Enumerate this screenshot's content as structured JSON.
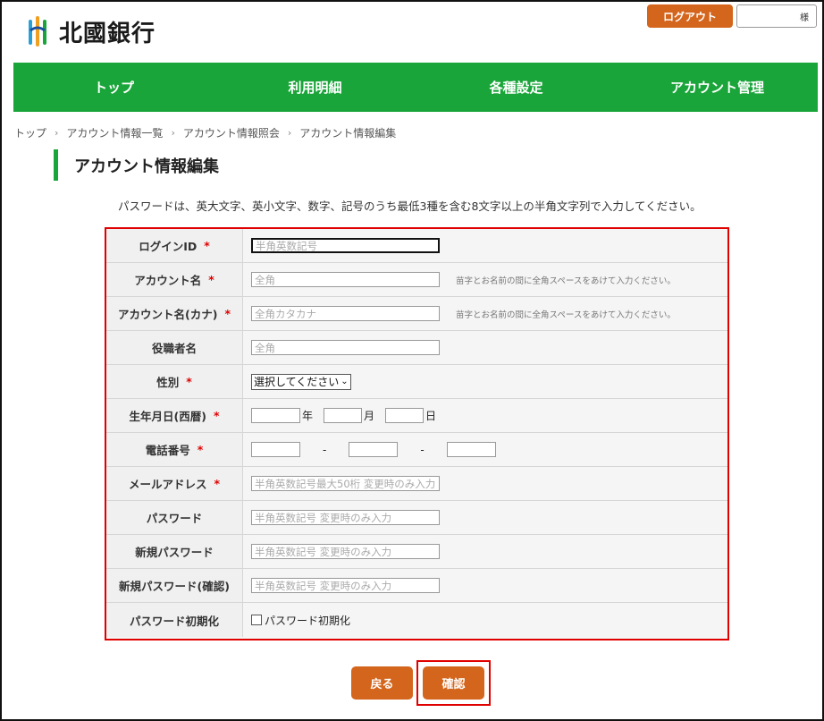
{
  "header": {
    "bank_name": "北國銀行",
    "logout_label": "ログアウト",
    "user_suffix": "様"
  },
  "nav": [
    {
      "label": "トップ"
    },
    {
      "label": "利用明細"
    },
    {
      "label": "各種設定"
    },
    {
      "label": "アカウント管理"
    }
  ],
  "breadcrumb": [
    {
      "label": "トップ"
    },
    {
      "label": "アカウント情報一覧"
    },
    {
      "label": "アカウント情報照会"
    },
    {
      "label": "アカウント情報編集"
    }
  ],
  "page_title": "アカウント情報編集",
  "notice": "パスワードは、英大文字、英小文字、数字、記号のうち最低3種を含む8文字以上の半角文字列で入力してください。",
  "form": {
    "login_id": {
      "label": "ログインID",
      "placeholder": "半角英数記号"
    },
    "account_name": {
      "label": "アカウント名",
      "placeholder": "全角",
      "hint": "苗字とお名前の間に全角スペースをあけて入力ください。"
    },
    "account_kana": {
      "label": "アカウント名(カナ)",
      "placeholder": "全角カタカナ",
      "hint": "苗字とお名前の間に全角スペースをあけて入力ください。"
    },
    "title": {
      "label": "役職者名",
      "placeholder": "全角"
    },
    "gender": {
      "label": "性別",
      "selected": "選択してください"
    },
    "birthdate": {
      "label": "生年月日(西暦)",
      "year_unit": "年",
      "month_unit": "月",
      "day_unit": "日"
    },
    "phone": {
      "label": "電話番号",
      "sep1": "-",
      "sep2": "-"
    },
    "email": {
      "label": "メールアドレス",
      "placeholder": "半角英数記号最大50桁 変更時のみ入力"
    },
    "password": {
      "label": "パスワード",
      "placeholder": "半角英数記号 変更時のみ入力"
    },
    "new_password": {
      "label": "新規パスワード",
      "placeholder": "半角英数記号 変更時のみ入力"
    },
    "new_password_confirm": {
      "label": "新規パスワード(確認)",
      "placeholder": "半角英数記号 変更時のみ入力"
    },
    "password_reset": {
      "label": "パスワード初期化",
      "checkbox_label": "パスワード初期化"
    },
    "required_mark": "*"
  },
  "buttons": {
    "back": "戻る",
    "confirm": "確認"
  },
  "colors": {
    "nav_green": "#1aa53a",
    "button_orange": "#d4651c",
    "highlight_red": "#e00000"
  }
}
